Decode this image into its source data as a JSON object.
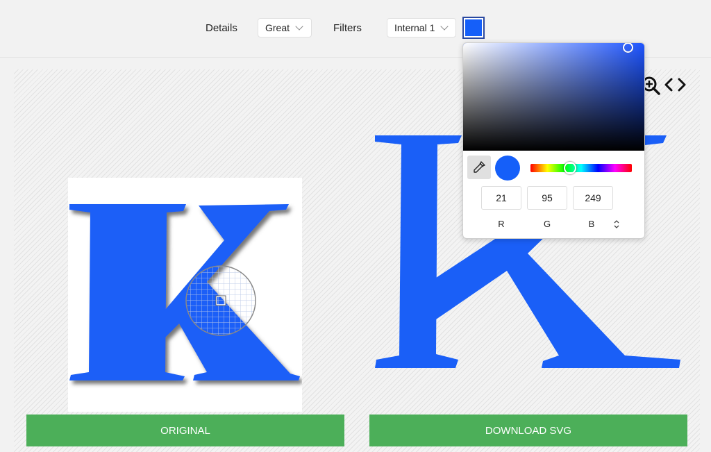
{
  "toolbar": {
    "details_label": "Details",
    "details_value": "Great",
    "filters_label": "Filters",
    "filters_value": "Internal 1",
    "swatch_color": "#155ff9"
  },
  "letter": {
    "text": "K",
    "color": "#1a5ff7",
    "shadow": "#555555"
  },
  "viewer_icons": [
    "zoom-in-icon",
    "code-icon"
  ],
  "color_picker": {
    "hue_color": "#1e55ff",
    "r": "21",
    "g": "95",
    "b": "249",
    "r_label": "R",
    "g_label": "G",
    "b_label": "B",
    "preview_color": "#155ff9"
  },
  "buttons": {
    "original": "ORIGINAL",
    "download": "DOWNLOAD SVG"
  },
  "colors": {
    "accent_green": "#4caf59"
  }
}
